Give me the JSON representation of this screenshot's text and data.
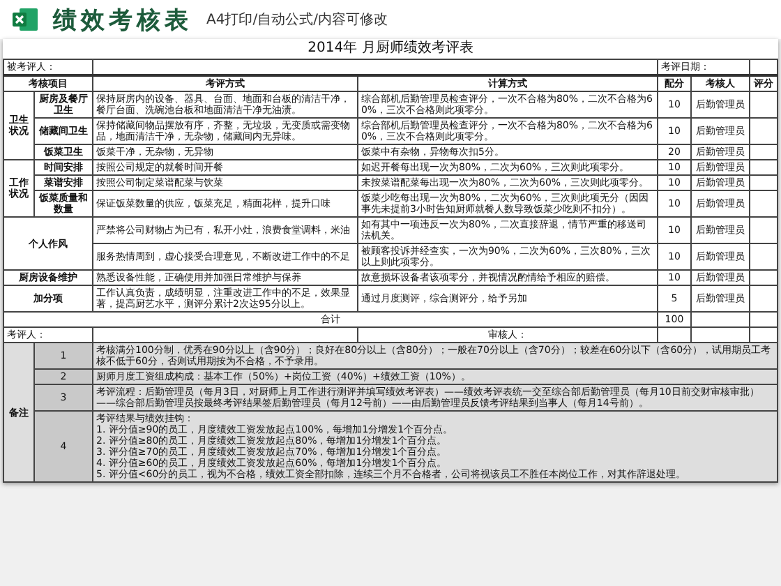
{
  "header": {
    "title": "绩效考核表",
    "subtitle": "A4打印/自动公式/内容可修改"
  },
  "sheet": {
    "title": "2014年 月厨师绩效考评表",
    "assessee_label": "被考评人：",
    "date_label": "考评日期：",
    "columns": [
      "考核项目",
      "考评方式",
      "计算方式",
      "配分",
      "考核人",
      "评分"
    ],
    "groups": [
      {
        "kind": "split",
        "category": "卫生状况",
        "items": [
          {
            "item": "厨房及餐厅卫生",
            "method": "保持厨房内的设备、器具、台面、地面和台板的清洁干净，餐厅台面、洗碗池台板和地面清洁干净无油渍。",
            "calculation": "综合部机后勤管理员检查评分，一次不合格为80%，二次不合格为60%，三次不合格则此项零分。",
            "points": "10",
            "assessor": "后勤管理员"
          },
          {
            "item": "储藏间卫生",
            "method": "保持储藏间物品摆放有序，齐整，无垃圾，无变质或需变物品，地面清洁干净，无杂物，储藏间内无异味。",
            "calculation": "综合部机后勤管理员检查评分，一次不合格为80%，二次不合格为60%，三次不合格则此项零分。",
            "points": "10",
            "assessor": "后勤管理员"
          },
          {
            "item": "饭菜卫生",
            "method": "饭菜干净，无杂物，无异物",
            "calculation": "饭菜中有杂物，异物每次扣5分。",
            "points": "20",
            "assessor": "后勤管理员"
          }
        ]
      },
      {
        "kind": "split",
        "category": "工作状况",
        "items": [
          {
            "item": "时间安排",
            "method": "按照公司规定的就餐时间开餐",
            "calculation": "如迟开餐每出现一次为80%，二次为60%，三次则此项零分。",
            "points": "10",
            "assessor": "后勤管理员"
          },
          {
            "item": "菜谱安排",
            "method": "按照公司制定菜谱配菜与饮菜",
            "calculation": "未按菜谱配菜每出现一次为80%，二次为60%，三次则此项零分。",
            "points": "10",
            "assessor": "后勤管理员"
          },
          {
            "item": "饭菜质量和数量",
            "method": "保证饭菜数量的供应，饭菜充足，精面花样，提升口味",
            "calculation": "饭菜少吃每出现一次为80%，二次为60%，三次则此项无分（因因事先未提前3小时告知厨师就餐人数导致饭菜少吃则不扣分）。",
            "points": "10",
            "assessor": "后勤管理员"
          }
        ]
      },
      {
        "kind": "merged",
        "category": "个人作风",
        "items": [
          {
            "method": "严禁将公司财物占为已有，私开小灶，浪费食堂调料，米油",
            "calculation": "如有其中一项违反一次为80%，二次直接辞退，情节严重的移送司法机关。",
            "points": "10",
            "assessor": "后勤管理员"
          },
          {
            "method": "服务热情周到，虚心接受合理意见，不断改进工作中的不足",
            "calculation": "被顾客投诉并经查实，一次为90%，二次为60%，三次80%，三次以上则此项零分。",
            "points": "10",
            "assessor": "后勤管理员"
          }
        ]
      },
      {
        "kind": "merged",
        "category": "厨房设备维护",
        "items": [
          {
            "method": "熟悉设备性能，正确使用并加强日常维护与保养",
            "calculation": "故意损坏设备者该项零分，并视情况酌情给予相应的赔偿。",
            "points": "10",
            "assessor": "后勤管理员"
          }
        ]
      },
      {
        "kind": "merged",
        "category": "加分项",
        "items": [
          {
            "method": "工作认真负责，成绩明显，注重改进工作中的不足，效果显著，提高厨艺水平，测评分累计2次达95分以上。",
            "calculation": "通过月度测评，综合测评分，给予另加",
            "points": "5",
            "assessor": "后勤管理员"
          }
        ]
      }
    ],
    "total_label": "合计",
    "total_points": "100",
    "reviewer_label": "考评人：",
    "auditor_label": "审核人：",
    "notes_label": "备注",
    "notes": [
      {
        "number": "1",
        "lines": [
          "考核满分100分制，优秀在90分以上（含90分）；良好在80分以上（含80分）；一般在70分以上（含70分）；较差在60分以下（含60分），试用期员工考核不低于60分，否则试用期按为不合格，不予录用。"
        ]
      },
      {
        "number": "2",
        "lines": [
          "厨师月度工资组成构成：基本工作（50%）+岗位工资（40%）+绩效工资（10%）。"
        ]
      },
      {
        "number": "3",
        "lines": [
          "考评流程：后勤管理员（每月3日，对厨师上月工作进行测评并填写绩效考评表）——绩效考评表统一交至综合部后勤管理员（每月10日前交财审核审批）——综合部后勤管理员按最终考评结果签后勤管理员（每月12号前）——由后勤管理员反馈考评结果到当事人（每月14号前）。"
        ]
      },
      {
        "number": "4",
        "lines": [
          "考评结果与绩效挂钩：",
          "1. 评分值≥90的员工，月度绩效工资发放起点100%，每增加1分增发1个百分点。",
          "2. 评分值≥80的员工，月度绩效工资发放起点80%，每增加1分增发1个百分点。",
          "3. 评分值≥70的员工，月度绩效工资发放起点70%，每增加1分增发1个百分点。",
          "4. 评分值≥60的员工，月度绩效工资发放起点60%，每增加1分增发1个百分点。",
          "5. 评分值<60分的员工，视为不合格，绩效工资全部扣除，连续三个月不合格者，公司将视该员工不胜任本岗位工作，对其作辞退处理。"
        ]
      }
    ]
  }
}
